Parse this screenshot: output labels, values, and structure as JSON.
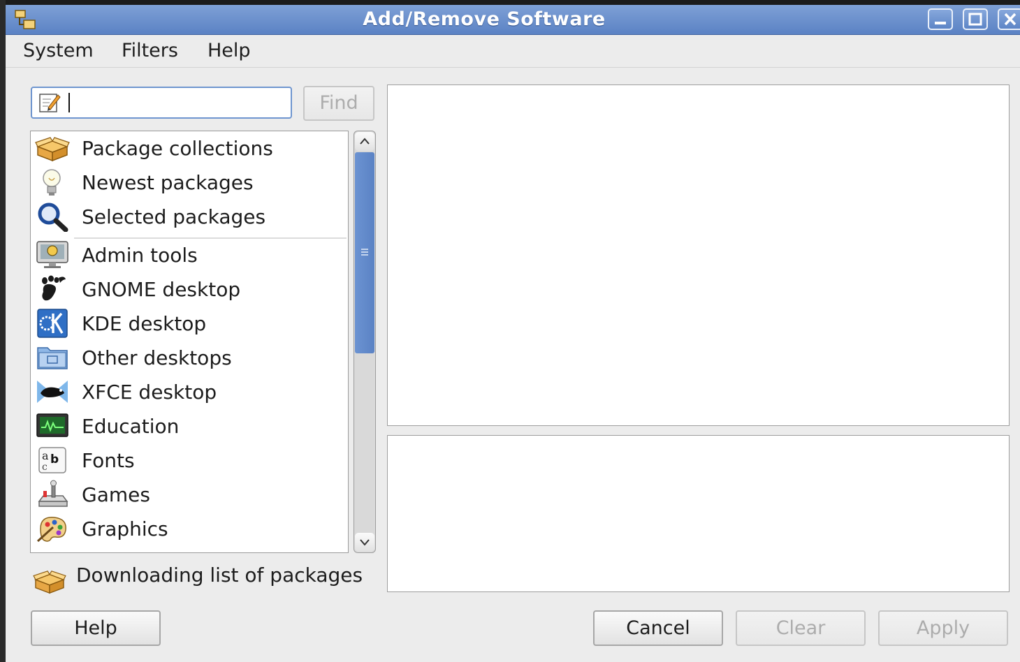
{
  "window": {
    "title": "Add/Remove Software"
  },
  "menu": {
    "items": [
      "System",
      "Filters",
      "Help"
    ]
  },
  "search": {
    "value": "",
    "find_label": "Find"
  },
  "categories": {
    "groups": [
      {
        "label": "Package collections",
        "icon": "package-box-icon"
      },
      {
        "label": "Newest packages",
        "icon": "lightbulb-icon"
      },
      {
        "label": "Selected packages",
        "icon": "magnifier-icon"
      }
    ],
    "items": [
      {
        "label": "Admin tools",
        "icon": "admin-monitor-icon"
      },
      {
        "label": "GNOME desktop",
        "icon": "gnome-foot-icon"
      },
      {
        "label": "KDE desktop",
        "icon": "kde-logo-icon"
      },
      {
        "label": "Other desktops",
        "icon": "desktop-folder-icon"
      },
      {
        "label": "XFCE desktop",
        "icon": "xfce-mouse-icon"
      },
      {
        "label": "Education",
        "icon": "education-monitor-icon"
      },
      {
        "label": "Fonts",
        "icon": "fonts-icon"
      },
      {
        "label": "Games",
        "icon": "joystick-icon"
      },
      {
        "label": "Graphics",
        "icon": "palette-icon"
      }
    ]
  },
  "status": {
    "text": "Downloading list of packages",
    "icon": "package-box-icon"
  },
  "buttons": {
    "help": "Help",
    "cancel": "Cancel",
    "clear": "Clear",
    "apply": "Apply"
  },
  "theme": {
    "titlebar": "#6a8fcd",
    "accent": "#5a82c4",
    "window_bg": "#ececec"
  }
}
